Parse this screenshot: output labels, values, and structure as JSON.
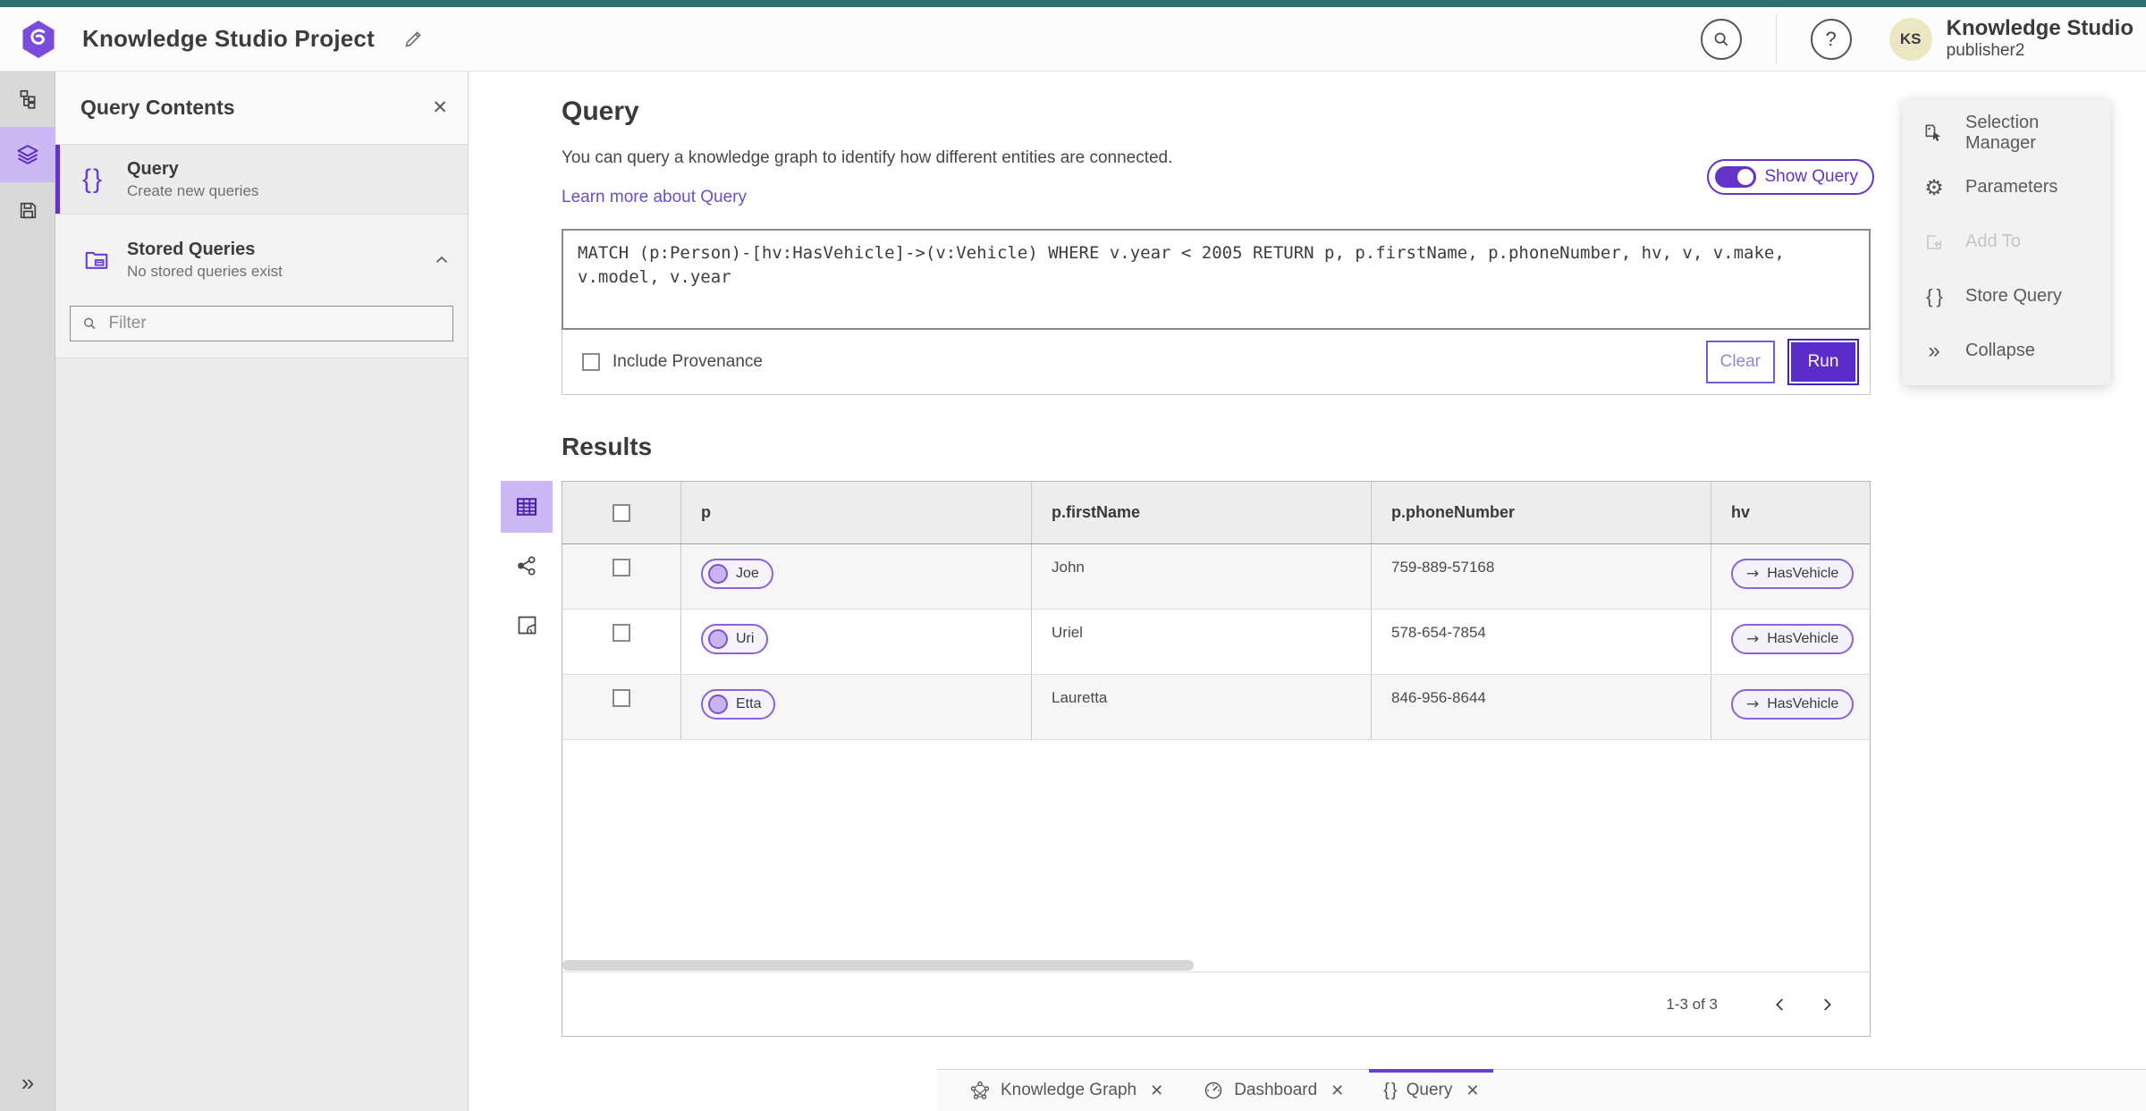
{
  "colors": {
    "accent_purple": "#6434c9",
    "run_purple": "#5b2cc9",
    "teal_strip": "#2e6c72",
    "rail_active_bg": "#cbb8f5",
    "pill_border": "#8a63d9"
  },
  "header": {
    "app_title": "Knowledge Studio Project",
    "user_name": "Knowledge Studio",
    "user_role": "publisher2",
    "avatar_initials": "KS",
    "help_glyph": "?"
  },
  "left_panel": {
    "title": "Query Contents",
    "close_glyph": "✕",
    "query_item": {
      "title": "Query",
      "subtitle": "Create new queries"
    },
    "stored_queries": {
      "title": "Stored Queries",
      "subtitle": "No stored queries exist"
    },
    "filter_placeholder": "Filter"
  },
  "query_section": {
    "title": "Query",
    "description": "You can query a knowledge graph to identify how different entities are connected.",
    "learn_more": "Learn more about Query",
    "show_query_label": "Show Query",
    "query_text": "MATCH (p:Person)-[hv:HasVehicle]->(v:Vehicle) WHERE v.year < 2005 RETURN p, p.firstName, p.phoneNumber, hv, v, v.make, v.model, v.year",
    "include_provenance_label": "Include Provenance",
    "clear_label": "Clear",
    "run_label": "Run"
  },
  "results": {
    "title": "Results",
    "columns": [
      "p",
      "p.firstName",
      "p.phoneNumber",
      "hv"
    ],
    "edge_arrow": "→",
    "rows": [
      {
        "p": "Joe",
        "firstName": "John",
        "phoneNumber": "759-889-57168",
        "hv": "HasVehicle"
      },
      {
        "p": "Uri",
        "firstName": "Uriel",
        "phoneNumber": "578-654-7854",
        "hv": "HasVehicle"
      },
      {
        "p": "Etta",
        "firstName": "Lauretta",
        "phoneNumber": "846-956-8644",
        "hv": "HasVehicle"
      }
    ],
    "pagination": {
      "label": "1-3 of 3"
    }
  },
  "right_panel": {
    "items": [
      {
        "label": "Selection Manager"
      },
      {
        "label": "Parameters"
      },
      {
        "label": "Add To"
      },
      {
        "label": "Store Query"
      },
      {
        "label": "Collapse"
      }
    ],
    "gear_glyph": "⚙",
    "collapse_glyph": "»",
    "braces_glyph": "{ }"
  },
  "rail": {
    "expand_glyph": "»"
  },
  "bottom_tabs": [
    {
      "label": "Knowledge Graph",
      "close_glyph": "✕"
    },
    {
      "label": "Dashboard",
      "close_glyph": "✕"
    },
    {
      "label": "Query",
      "close_glyph": "✕"
    }
  ]
}
